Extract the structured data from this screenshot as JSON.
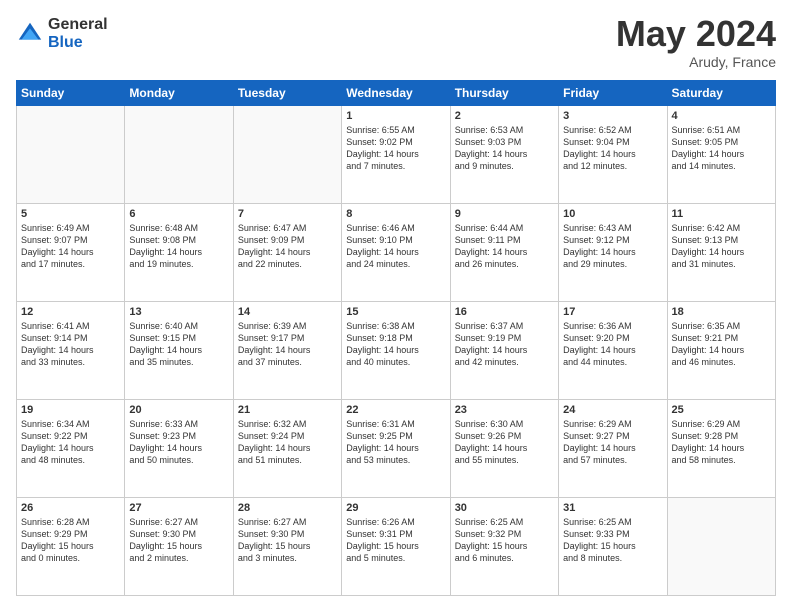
{
  "header": {
    "logo_general": "General",
    "logo_blue": "Blue",
    "month_title": "May 2024",
    "location": "Arudy, France"
  },
  "days_of_week": [
    "Sunday",
    "Monday",
    "Tuesday",
    "Wednesday",
    "Thursday",
    "Friday",
    "Saturday"
  ],
  "weeks": [
    [
      {
        "day": "",
        "info": ""
      },
      {
        "day": "",
        "info": ""
      },
      {
        "day": "",
        "info": ""
      },
      {
        "day": "1",
        "info": "Sunrise: 6:55 AM\nSunset: 9:02 PM\nDaylight: 14 hours\nand 7 minutes."
      },
      {
        "day": "2",
        "info": "Sunrise: 6:53 AM\nSunset: 9:03 PM\nDaylight: 14 hours\nand 9 minutes."
      },
      {
        "day": "3",
        "info": "Sunrise: 6:52 AM\nSunset: 9:04 PM\nDaylight: 14 hours\nand 12 minutes."
      },
      {
        "day": "4",
        "info": "Sunrise: 6:51 AM\nSunset: 9:05 PM\nDaylight: 14 hours\nand 14 minutes."
      }
    ],
    [
      {
        "day": "5",
        "info": "Sunrise: 6:49 AM\nSunset: 9:07 PM\nDaylight: 14 hours\nand 17 minutes."
      },
      {
        "day": "6",
        "info": "Sunrise: 6:48 AM\nSunset: 9:08 PM\nDaylight: 14 hours\nand 19 minutes."
      },
      {
        "day": "7",
        "info": "Sunrise: 6:47 AM\nSunset: 9:09 PM\nDaylight: 14 hours\nand 22 minutes."
      },
      {
        "day": "8",
        "info": "Sunrise: 6:46 AM\nSunset: 9:10 PM\nDaylight: 14 hours\nand 24 minutes."
      },
      {
        "day": "9",
        "info": "Sunrise: 6:44 AM\nSunset: 9:11 PM\nDaylight: 14 hours\nand 26 minutes."
      },
      {
        "day": "10",
        "info": "Sunrise: 6:43 AM\nSunset: 9:12 PM\nDaylight: 14 hours\nand 29 minutes."
      },
      {
        "day": "11",
        "info": "Sunrise: 6:42 AM\nSunset: 9:13 PM\nDaylight: 14 hours\nand 31 minutes."
      }
    ],
    [
      {
        "day": "12",
        "info": "Sunrise: 6:41 AM\nSunset: 9:14 PM\nDaylight: 14 hours\nand 33 minutes."
      },
      {
        "day": "13",
        "info": "Sunrise: 6:40 AM\nSunset: 9:15 PM\nDaylight: 14 hours\nand 35 minutes."
      },
      {
        "day": "14",
        "info": "Sunrise: 6:39 AM\nSunset: 9:17 PM\nDaylight: 14 hours\nand 37 minutes."
      },
      {
        "day": "15",
        "info": "Sunrise: 6:38 AM\nSunset: 9:18 PM\nDaylight: 14 hours\nand 40 minutes."
      },
      {
        "day": "16",
        "info": "Sunrise: 6:37 AM\nSunset: 9:19 PM\nDaylight: 14 hours\nand 42 minutes."
      },
      {
        "day": "17",
        "info": "Sunrise: 6:36 AM\nSunset: 9:20 PM\nDaylight: 14 hours\nand 44 minutes."
      },
      {
        "day": "18",
        "info": "Sunrise: 6:35 AM\nSunset: 9:21 PM\nDaylight: 14 hours\nand 46 minutes."
      }
    ],
    [
      {
        "day": "19",
        "info": "Sunrise: 6:34 AM\nSunset: 9:22 PM\nDaylight: 14 hours\nand 48 minutes."
      },
      {
        "day": "20",
        "info": "Sunrise: 6:33 AM\nSunset: 9:23 PM\nDaylight: 14 hours\nand 50 minutes."
      },
      {
        "day": "21",
        "info": "Sunrise: 6:32 AM\nSunset: 9:24 PM\nDaylight: 14 hours\nand 51 minutes."
      },
      {
        "day": "22",
        "info": "Sunrise: 6:31 AM\nSunset: 9:25 PM\nDaylight: 14 hours\nand 53 minutes."
      },
      {
        "day": "23",
        "info": "Sunrise: 6:30 AM\nSunset: 9:26 PM\nDaylight: 14 hours\nand 55 minutes."
      },
      {
        "day": "24",
        "info": "Sunrise: 6:29 AM\nSunset: 9:27 PM\nDaylight: 14 hours\nand 57 minutes."
      },
      {
        "day": "25",
        "info": "Sunrise: 6:29 AM\nSunset: 9:28 PM\nDaylight: 14 hours\nand 58 minutes."
      }
    ],
    [
      {
        "day": "26",
        "info": "Sunrise: 6:28 AM\nSunset: 9:29 PM\nDaylight: 15 hours\nand 0 minutes."
      },
      {
        "day": "27",
        "info": "Sunrise: 6:27 AM\nSunset: 9:30 PM\nDaylight: 15 hours\nand 2 minutes."
      },
      {
        "day": "28",
        "info": "Sunrise: 6:27 AM\nSunset: 9:30 PM\nDaylight: 15 hours\nand 3 minutes."
      },
      {
        "day": "29",
        "info": "Sunrise: 6:26 AM\nSunset: 9:31 PM\nDaylight: 15 hours\nand 5 minutes."
      },
      {
        "day": "30",
        "info": "Sunrise: 6:25 AM\nSunset: 9:32 PM\nDaylight: 15 hours\nand 6 minutes."
      },
      {
        "day": "31",
        "info": "Sunrise: 6:25 AM\nSunset: 9:33 PM\nDaylight: 15 hours\nand 8 minutes."
      },
      {
        "day": "",
        "info": ""
      }
    ]
  ]
}
